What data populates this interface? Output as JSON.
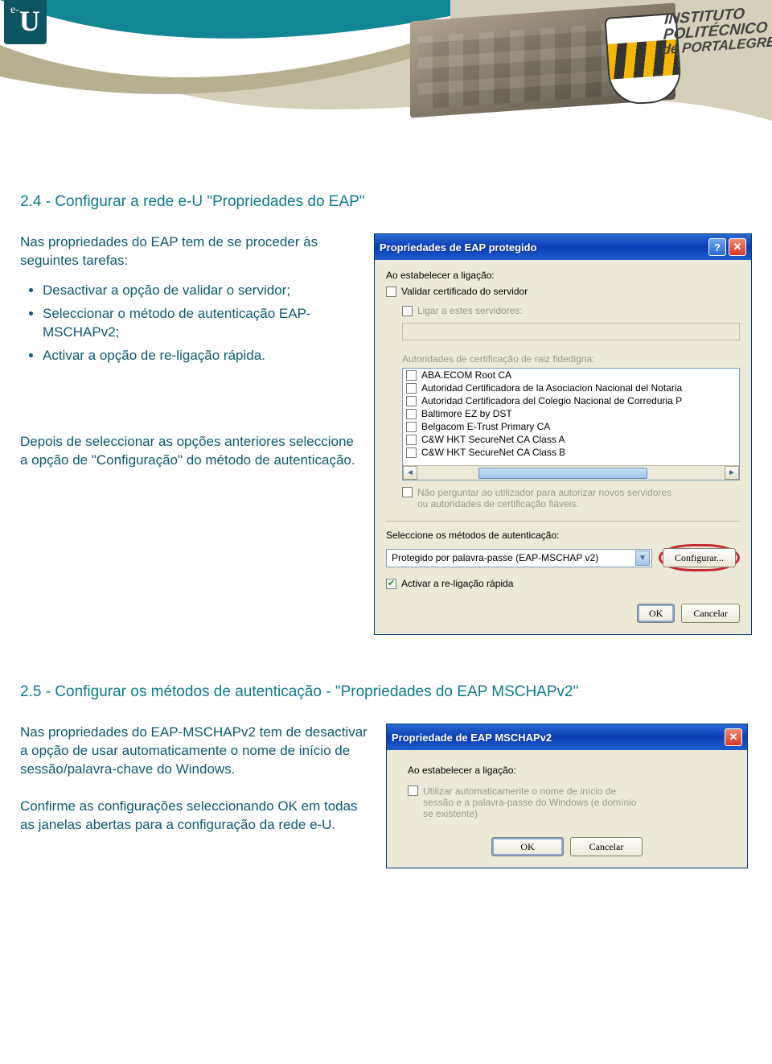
{
  "header": {
    "eu_e": "e-",
    "eu_u": "U",
    "ipp_line1": "INSTITUTO",
    "ipp_line2": "POLITÉCNICO",
    "ipp_line3": "de PORTALEGRE"
  },
  "section24": {
    "title": "2.4 - Configurar a rede e-U \"Propriedades do EAP\"",
    "intro": "Nas propriedades do EAP tem de se proceder às seguintes tarefas:",
    "bullets": [
      "Desactivar a opção de validar o servidor;",
      "Seleccionar o método de autenticação EAP-MSCHAPv2;",
      "Activar a opção de re-ligação rápida."
    ],
    "after": "Depois de seleccionar as opções anteriores seleccione a opção de \"Configuração\" do método de autenticação."
  },
  "dialog1": {
    "title": "Propriedades de EAP protegido",
    "lbl_estab": "Ao estabelecer a ligação:",
    "chk_validate": "Validar certificado do servidor",
    "chk_ligar": "Ligar a estes servidores:",
    "lbl_auth_root": "Autoridades de certificação de raiz fidedigna:",
    "ca_list": [
      "ABA.ECOM Root CA",
      "Autoridad Certificadora de la Asociacion Nacional del Notaria",
      "Autoridad Certificadora del Colegio Nacional de Correduria P",
      "Baltimore EZ by DST",
      "Belgacom E-Trust Primary CA",
      "C&W HKT SecureNet CA Class A",
      "C&W HKT SecureNet CA Class B"
    ],
    "chk_noprompt_l1": "Não perguntar ao utilizador para autorizar novos servidores",
    "chk_noprompt_l2": "ou autoridades de certificação fiáveis.",
    "lbl_select_method": "Seleccione os métodos de autenticação:",
    "method_value": "Protegido por palavra-passe (EAP-MSCHAP v2)",
    "btn_configure": "Configurar...",
    "chk_fast": "Activar a re-ligação rápida",
    "btn_ok": "OK",
    "btn_cancel": "Cancelar"
  },
  "section25": {
    "title": "2.5 - Configurar os métodos de autenticação - \"Propriedades do EAP MSCHAPv2\"",
    "p1": "Nas propriedades do EAP-MSCHAPv2 tem de desactivar a opção de usar automaticamente o nome de início de sessão/palavra-chave do Windows.",
    "p2": "Confirme as configurações seleccionando OK em todas as janelas abertas para a configuração da rede e-U."
  },
  "dialog2": {
    "title": "Propriedade de EAP MSCHAPv2",
    "lbl_estab": "Ao estabelecer a ligação:",
    "chk_auto_l1": "Utilizar automaticamente o nome de início de",
    "chk_auto_l2": "sessão e a palavra-passe do Windows (e domínio",
    "chk_auto_l3": "se existente)",
    "btn_ok": "OK",
    "btn_cancel": "Cancelar"
  }
}
